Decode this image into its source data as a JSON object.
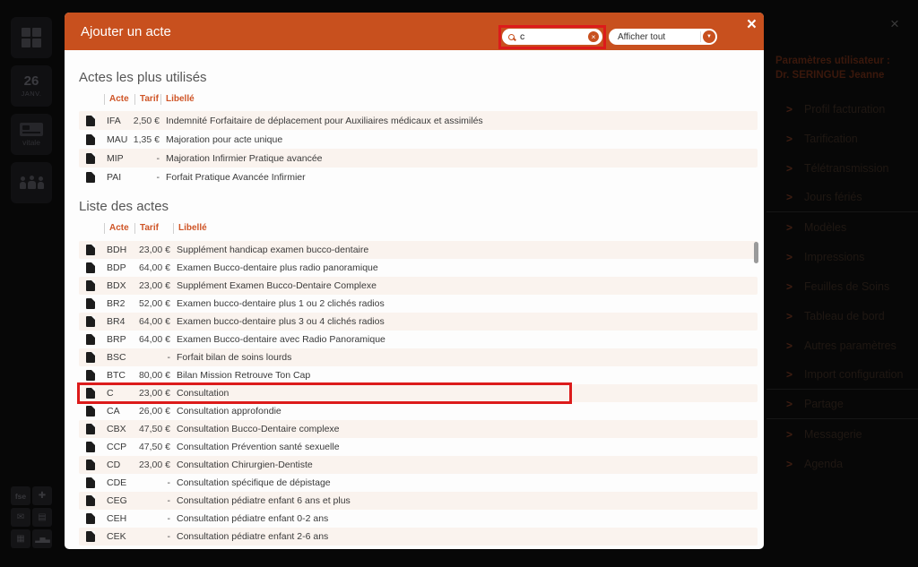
{
  "app": {
    "close_icon": "×"
  },
  "colors": {
    "accent_orange": "#c8501e",
    "table_header_orange": "#cf5527",
    "annotation_red": "#dc1b1b",
    "row_stripe": "#faf3ee"
  },
  "modal": {
    "title": "Ajouter un acte",
    "close_icon": "×",
    "search": {
      "value": "c",
      "icon": "magnifier",
      "clear_icon": "×"
    },
    "filter": {
      "label": "Afficher tout",
      "caret_icon": "▼"
    },
    "annotations": {
      "search_box_highlighted": true,
      "highlighted_row_acte": "C"
    },
    "sections": [
      {
        "title": "Actes les plus utilisés",
        "columns": [
          "Acte",
          "Tarif",
          "Libellé"
        ],
        "rows": [
          {
            "acte": "IFA",
            "tarif": "2,50 €",
            "libelle": "Indemnité Forfaitaire de déplacement pour Auxiliaires médicaux et assimilés"
          },
          {
            "acte": "MAU",
            "tarif": "1,35 €",
            "libelle": "Majoration pour acte unique"
          },
          {
            "acte": "MIP",
            "tarif": "-",
            "libelle": "Majoration Infirmier Pratique avancée"
          },
          {
            "acte": "PAI",
            "tarif": "-",
            "libelle": "Forfait Pratique Avancée Infirmier"
          }
        ]
      },
      {
        "title": "Liste des actes",
        "columns": [
          "Acte",
          "Tarif",
          "Libellé"
        ],
        "rows": [
          {
            "acte": "BDH",
            "tarif": "23,00 €",
            "libelle": "Supplément handicap examen bucco-dentaire"
          },
          {
            "acte": "BDP",
            "tarif": "64,00 €",
            "libelle": "Examen Bucco-dentaire plus radio panoramique"
          },
          {
            "acte": "BDX",
            "tarif": "23,00 €",
            "libelle": "Supplément Examen Bucco-Dentaire Complexe"
          },
          {
            "acte": "BR2",
            "tarif": "52,00 €",
            "libelle": "Examen bucco-dentaire plus 1 ou 2 clichés radios"
          },
          {
            "acte": "BR4",
            "tarif": "64,00 €",
            "libelle": "Examen bucco-dentaire plus 3 ou 4 clichés radios"
          },
          {
            "acte": "BRP",
            "tarif": "64,00 €",
            "libelle": "Examen Bucco-dentaire avec Radio Panoramique"
          },
          {
            "acte": "BSC",
            "tarif": "-",
            "libelle": "Forfait bilan de soins lourds"
          },
          {
            "acte": "BTC",
            "tarif": "80,00 €",
            "libelle": "Bilan Mission Retrouve Ton Cap"
          },
          {
            "acte": "C",
            "tarif": "23,00 €",
            "libelle": "Consultation",
            "highlighted": true
          },
          {
            "acte": "CA",
            "tarif": "26,00 €",
            "libelle": "Consultation approfondie"
          },
          {
            "acte": "CBX",
            "tarif": "47,50 €",
            "libelle": "Consultation Bucco-Dentaire complexe"
          },
          {
            "acte": "CCP",
            "tarif": "47,50 €",
            "libelle": "Consultation Prévention santé sexuelle"
          },
          {
            "acte": "CD",
            "tarif": "23,00 €",
            "libelle": "Consultation Chirurgien-Dentiste"
          },
          {
            "acte": "CDE",
            "tarif": "-",
            "libelle": "Consultation spécifique de dépistage"
          },
          {
            "acte": "CEG",
            "tarif": "-",
            "libelle": "Consultation pédiatre enfant 6 ans et plus"
          },
          {
            "acte": "CEH",
            "tarif": "-",
            "libelle": "Consultation pédiatre enfant 0-2 ans"
          },
          {
            "acte": "CEK",
            "tarif": "-",
            "libelle": "Consultation pédiatre enfant 2-6 ans"
          }
        ]
      }
    ]
  },
  "left_sidebar": {
    "date_tile": {
      "day": "26",
      "month": "JANV."
    },
    "vitale_label": "vitale",
    "bottom_tiles": [
      {
        "name": "fse",
        "glyph": "fse"
      },
      {
        "name": "first-aid",
        "glyph": "✚"
      },
      {
        "name": "mail",
        "glyph": "✉"
      },
      {
        "name": "document",
        "glyph": "▤"
      },
      {
        "name": "calculator",
        "glyph": "▦"
      },
      {
        "name": "bar-chart",
        "glyph": "▂▅▃"
      }
    ]
  },
  "right_panel": {
    "title_line1": "Paramètres utilisateur :",
    "title_line2": "Dr. SERINGUE Jeanne",
    "items": [
      "Profil facturation",
      "Tarification",
      "Télétransmission",
      "Jours fériés",
      "Modèles",
      "Impressions",
      "Feuilles de Soins",
      "Tableau de bord",
      "Autres paramètres",
      "Import configuration",
      "Partage",
      "Messagerie",
      "Agenda"
    ],
    "separators_after": [
      3,
      9,
      10
    ]
  }
}
